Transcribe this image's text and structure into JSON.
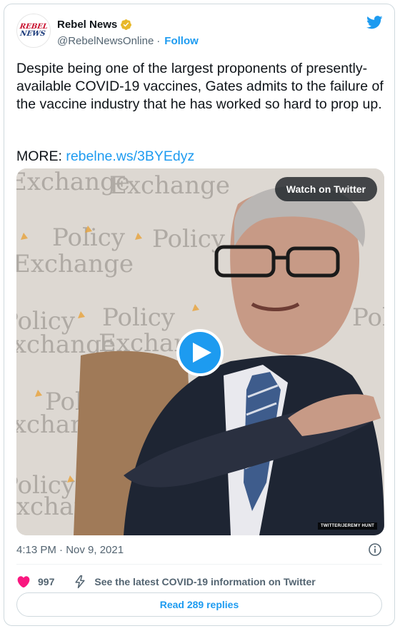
{
  "author": {
    "display_name": "Rebel News",
    "handle": "@RebelNewsOnline",
    "separator": "·",
    "follow_label": "Follow",
    "avatar_line1": "REBEL",
    "avatar_line2": "NEWS",
    "verified_color": "#e8b829"
  },
  "tweet": {
    "text": "Despite being one of the largest proponents of presently-available COVID-19 vaccines, Gates admits to the failure of the vaccine industry that he has worked so hard to prop up.",
    "more_prefix": "MORE: ",
    "link_text": "rebelne.ws/3BYEdyz"
  },
  "media": {
    "watch_label": "Watch on Twitter",
    "credit": "TWITTER/JEREMY HUNT",
    "backdrop_words": [
      "Policy",
      "Exchange"
    ]
  },
  "meta": {
    "timestamp": "4:13 PM · Nov 9, 2021"
  },
  "actions": {
    "like_count": "997",
    "covid_info": "See the latest COVID-19 information on Twitter",
    "read_replies": "Read 289 replies"
  },
  "colors": {
    "accent": "#1d9bf0",
    "heart": "#f91880",
    "text": "#0f1419",
    "secondary": "#536471"
  }
}
